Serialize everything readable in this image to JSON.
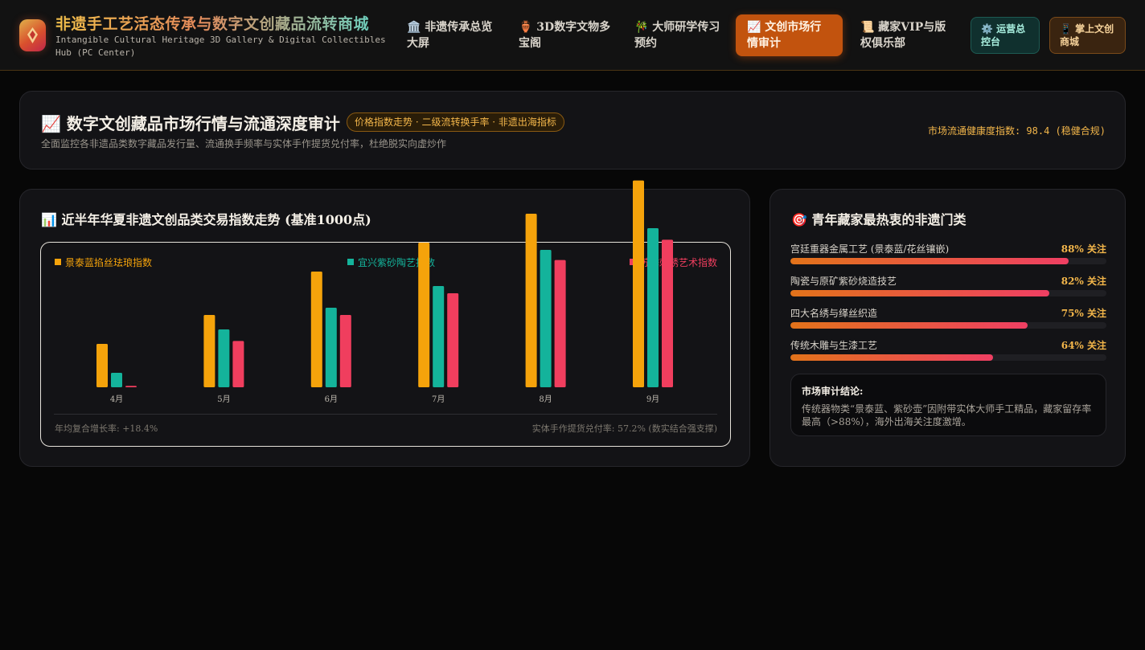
{
  "header": {
    "title": "非遗手工艺活态传承与数字文创藏品流转商城",
    "subtitle": "Intangible Cultural Heritage 3D Gallery & Digital Collectibles Hub (PC Center)",
    "nav": [
      {
        "icon": "museum-icon",
        "label": "🏛️ 非遗传承总览大屏"
      },
      {
        "icon": "vase-icon",
        "label": "🏺 3D数字文物多宝阁"
      },
      {
        "icon": "brush-icon",
        "label": "🎋 大师研学传习预约"
      },
      {
        "icon": "chart-icon",
        "label": "📈 文创市场行情审计"
      },
      {
        "icon": "scroll-icon",
        "label": "📜 藏家VIP与版权俱乐部"
      }
    ],
    "active_nav": 3,
    "ops_button": "⚙️ 运营总控台",
    "mall_button": "📱 掌上文创商城"
  },
  "summary": {
    "title": "📈 数字文创藏品市场行情与流通深度审计",
    "badge": "价格指数走势 · 二级流转换手率 · 非遗出海指标",
    "description": "全面监控各非遗品类数字藏品发行量、流通换手频率与实体手作提货兑付率，杜绝脱实向虚炒作",
    "health": "市场流通健康度指数: 98.4 (稳健合规)"
  },
  "chart_panel": {
    "title": "📊 近半年华夏非遗文创品类交易指数走势 (基准1000点)",
    "footer_left": "年均复合增长率: +18.4%",
    "footer_right": "实体手作提货兑付率: 57.2% (数实结合强支撑)"
  },
  "chart_data": {
    "type": "bar",
    "title": "近半年华夏非遗文创品类交易指数走势 (基准1000点)",
    "categories": [
      "4月",
      "5月",
      "6月",
      "7月",
      "8月",
      "9月"
    ],
    "series": [
      {
        "name": "景泰蓝掐丝珐琅指数",
        "color": "#f5a30b",
        "values": [
          1300,
          1500,
          1800,
          2000,
          2200,
          2430
        ]
      },
      {
        "name": "宜兴紫砂陶艺指数",
        "color": "#14b39b",
        "values": [
          1100,
          1400,
          1550,
          1700,
          1950,
          2100
        ]
      },
      {
        "name": "苏绣刺绣艺术指数",
        "color": "#f03e5e",
        "values": [
          1010,
          1320,
          1500,
          1650,
          1880,
          2020
        ]
      }
    ],
    "baseline": 1000,
    "legend": "top"
  },
  "side_panel": {
    "title": "🎯 青年藏家最热衷的非遗门类",
    "unit": "关注",
    "categories": [
      {
        "name": "宫廷重器金属工艺 (景泰蓝/花丝镶嵌)",
        "percent": 88
      },
      {
        "name": "陶瓷与原矿紫砂烧造技艺",
        "percent": 82
      },
      {
        "name": "四大名绣与缂丝织造",
        "percent": 75
      },
      {
        "name": "传统木雕与生漆工艺",
        "percent": 64
      }
    ],
    "conclusion_title": "市场审计结论:",
    "conclusion_text": "传统器物类“景泰蓝、紫砂壶”因附带实体大师手工精品，藏家留存率最高（>88%），海外出海关注度激增。"
  }
}
